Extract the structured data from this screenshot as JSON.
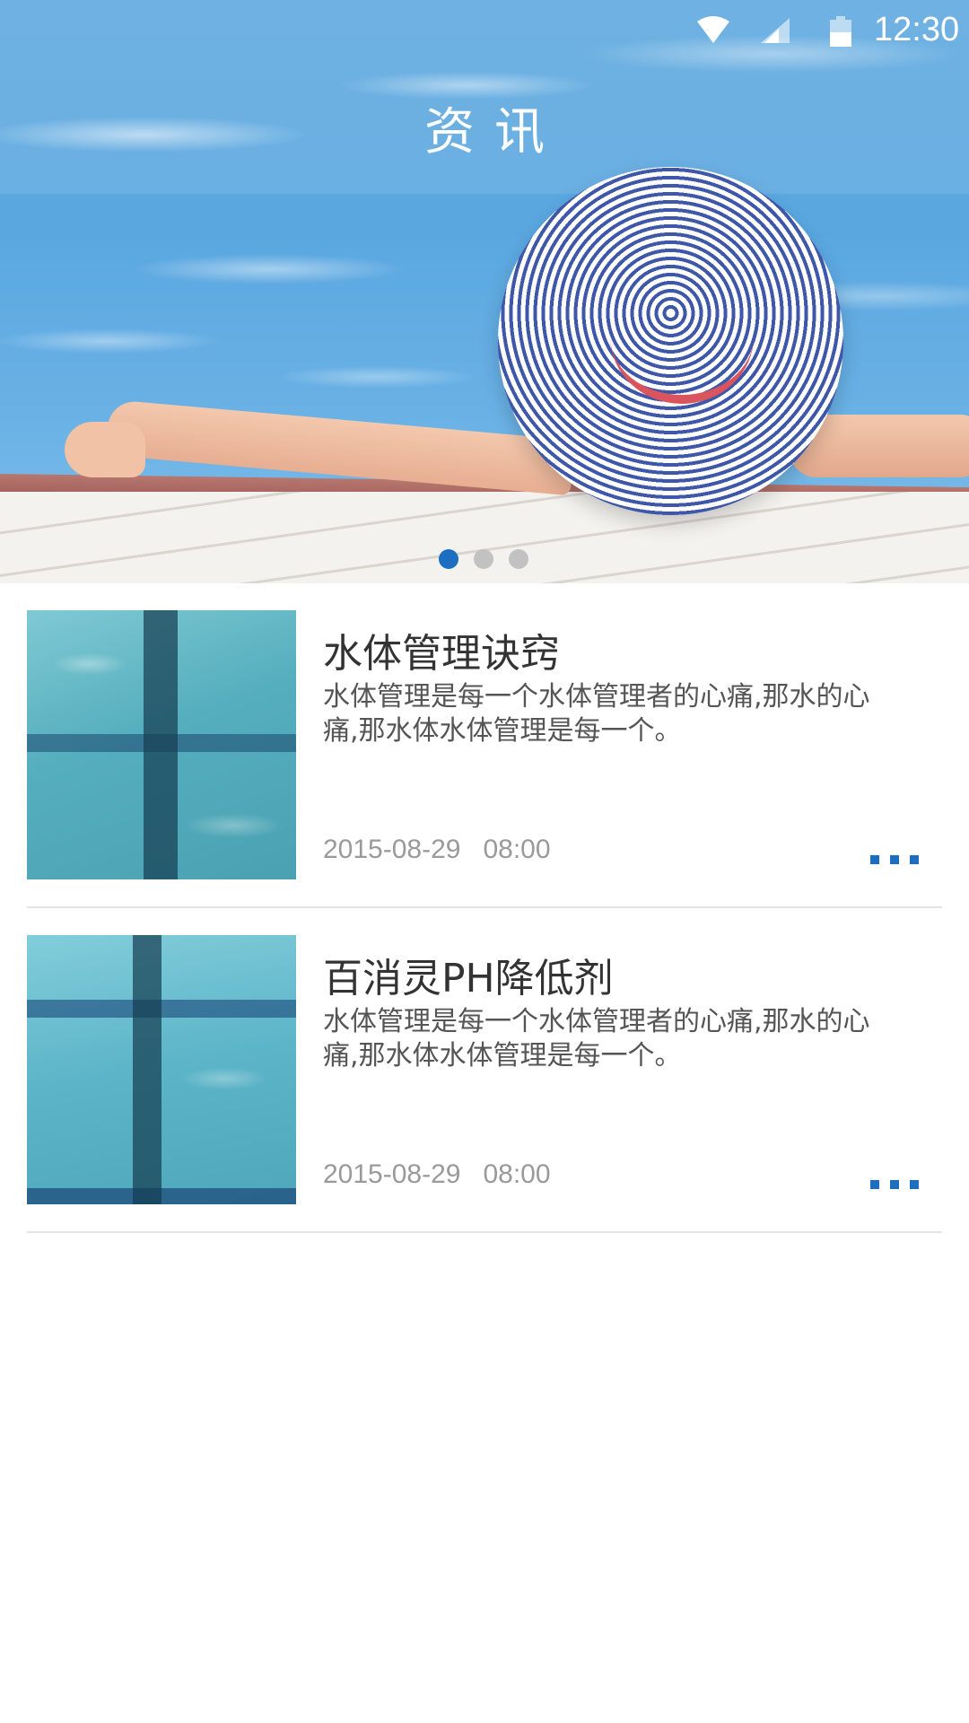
{
  "status_bar": {
    "time": "12:30",
    "icons": [
      "wifi-icon",
      "cell-signal-icon",
      "battery-icon"
    ]
  },
  "header": {
    "title": "资讯"
  },
  "carousel": {
    "dot_count": 3,
    "active_index": 0
  },
  "news": [
    {
      "title": "水体管理诀窍",
      "summary": "水体管理是每一个水体管理者的心痛,那水的心痛,那水体水体管理是每一个。",
      "date": "2015-08-29   08:00",
      "more_icon": "more-dots-icon"
    },
    {
      "title": "百消灵PH降低剂",
      "summary": "水体管理是每一个水体管理者的心痛,那水的心痛,那水体水体管理是每一个。",
      "date": "2015-08-29   08:00",
      "more_icon": "more-dots-icon"
    }
  ],
  "colors": {
    "accent": "#1c6fc0",
    "title_text": "#333333",
    "summary_text": "#555555",
    "date_text": "#9a9a9a",
    "divider": "#e4e4e4",
    "inactive_dot": "#c2c2c2"
  }
}
